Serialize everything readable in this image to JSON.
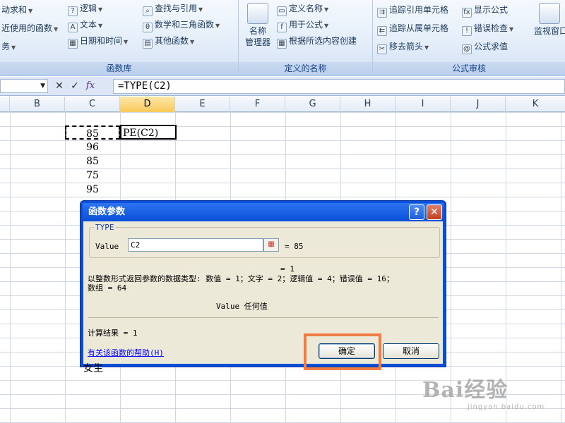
{
  "ribbon": {
    "group1": {
      "label": "函数库",
      "btn_autosum": "动求和",
      "btn_recent": "近使用的函数",
      "btn_finance": "务",
      "btn_logic": "逻辑",
      "btn_text": "文本",
      "btn_datetime": "日期和时间",
      "btn_lookup": "查找与引用",
      "btn_math": "数学和三角函数",
      "btn_other": "其他函数"
    },
    "group2": {
      "label": "定义的名称",
      "btn_name_mgr_line1": "名称",
      "btn_name_mgr_line2": "管理器",
      "btn_define_name": "定义名称",
      "btn_use_formula": "用于公式",
      "btn_create_sel": "根据所选内容创建"
    },
    "group3": {
      "label": "公式审核",
      "btn_trace_prec": "追踪引用单元格",
      "btn_trace_dep": "追踪从属单元格",
      "btn_remove_arrows": "移去箭头",
      "btn_show_formulas": "显示公式",
      "btn_error_check": "错误检查",
      "btn_eval_formula": "公式求值",
      "btn_watch": "监视窗口"
    }
  },
  "formula_bar": {
    "fx": "fx",
    "cancel": "✕",
    "enter": "✓",
    "formula": "=TYPE(C2)"
  },
  "columns": [
    "B",
    "C",
    "D",
    "E",
    "F",
    "G",
    "H",
    "I",
    "J",
    "K"
  ],
  "cells": {
    "c1": "85",
    "c2": "96",
    "c3": "85",
    "c4": "75",
    "c5": "95",
    "d1": "PE(C2)",
    "bottom": "女生"
  },
  "dialog": {
    "title": "函数参数",
    "help_btn": "?",
    "close_btn": "✕",
    "group_title": "TYPE",
    "value_label": "Value",
    "value_input": "C2",
    "value_result": "=  85",
    "result_eq": "=  1",
    "description": "以整数形式返回参数的数据类型: 数值 = 1；文字 = 2；逻辑值 = 4；错误值 = 16；\n数组 = 64",
    "param_name": "Value",
    "param_desc": "任何值",
    "calc_result": "计算结果 =  1",
    "help_link": "有关该函数的帮助(H)",
    "ok": "确定",
    "cancel": "取消"
  },
  "watermark": {
    "logo": "Bai经验",
    "url": "jingyan.baidu.com"
  }
}
